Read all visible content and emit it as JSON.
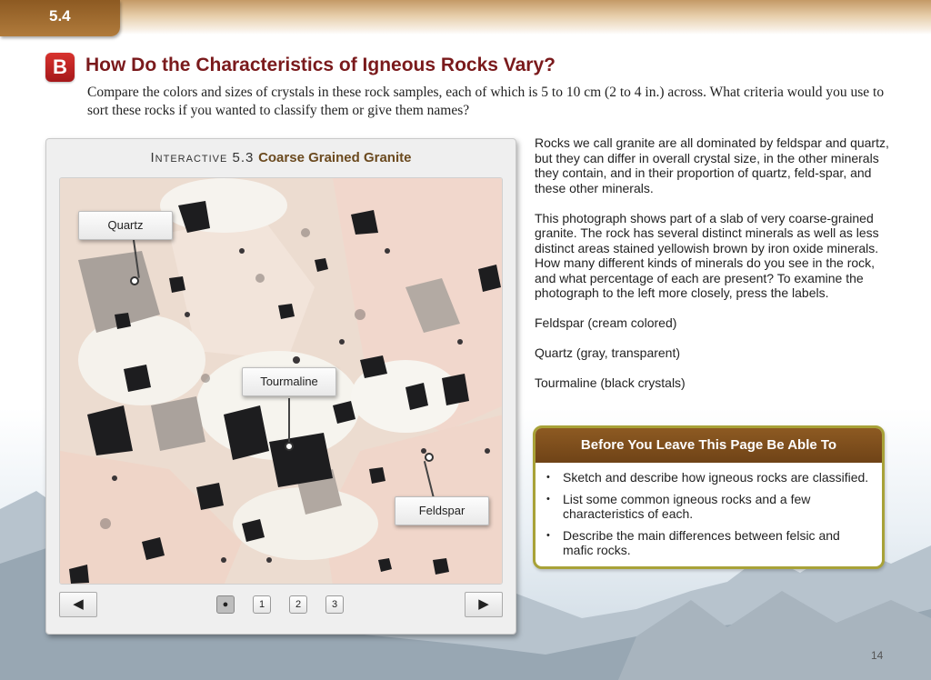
{
  "section": {
    "number": "5.4"
  },
  "heading": {
    "badge": "B",
    "title": "How Do the Characteristics of Igneous Rocks Vary?"
  },
  "intro": "Compare the colors and sizes of crystals in these rock samples, each of which is 5 to 10 cm (2 to 4 in.) across. What criteria would you use to sort these rocks if you wanted to classify them or give them names?",
  "interactive": {
    "prefix": "Interactive 5.3",
    "name": "Coarse Grained Granite",
    "labels": {
      "quartz": "Quartz",
      "tourmaline": "Tourmaline",
      "feldspar": "Feldspar"
    },
    "nav": {
      "prev": "◀",
      "next": "▶"
    },
    "pages": [
      "●",
      "1",
      "2",
      "3"
    ]
  },
  "body": {
    "p1": "Rocks we call granite are all dominated by feldspar and quartz, but they can differ in overall crystal size, in the other minerals they contain, and in their proportion of quartz, feld-spar, and these other minerals.",
    "p2": "This photograph shows part of a slab of very coarse-grained granite. The rock has several distinct minerals as well as less distinct areas stained yellowish brown by iron oxide minerals. How many different kinds of minerals do you see in the rock, and what percentage of each are present? To examine the photograph to the left more closely, press the labels.",
    "p3": "Feldspar (cream colored)",
    "p4": "Quartz (gray, transparent)",
    "p5": "Tourmaline (black crystals)"
  },
  "leave_box": {
    "title": "Before You Leave This Page Be Able To",
    "items": [
      "Sketch and describe how igneous rocks are classified.",
      "List some common igneous rocks and a few characteristics of each.",
      "Describe the main differences between felsic and mafic rocks."
    ]
  },
  "page_number": "14",
  "colors": {
    "heading": "#7a1a1c",
    "badge": "#c62828",
    "brown": "#8d5a22",
    "box_border": "#a8a238"
  }
}
